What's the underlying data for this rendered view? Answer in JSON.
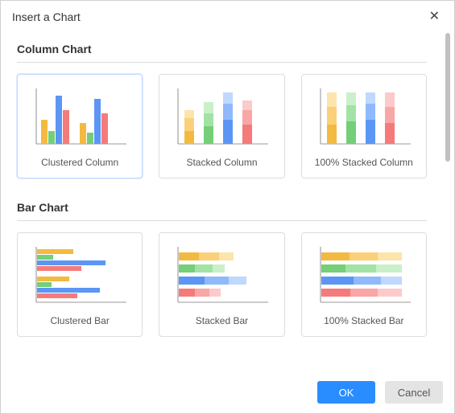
{
  "dialog": {
    "title": "Insert a Chart",
    "close_aria": "Close"
  },
  "sections": {
    "column": {
      "title": "Column Chart",
      "items": [
        {
          "label": "Clustered Column",
          "selected": true
        },
        {
          "label": "Stacked Column",
          "selected": false
        },
        {
          "label": "100% Stacked Column",
          "selected": false
        }
      ]
    },
    "bar": {
      "title": "Bar Chart",
      "items": [
        {
          "label": "Clustered Bar",
          "selected": false
        },
        {
          "label": "Stacked Bar",
          "selected": false
        },
        {
          "label": "100% Stacked Bar",
          "selected": false
        }
      ]
    }
  },
  "buttons": {
    "ok": "OK",
    "cancel": "Cancel"
  },
  "colors": {
    "primary": "#2a8dff",
    "border": "#dcdcdc",
    "selected_border": "#c2d9ff"
  }
}
